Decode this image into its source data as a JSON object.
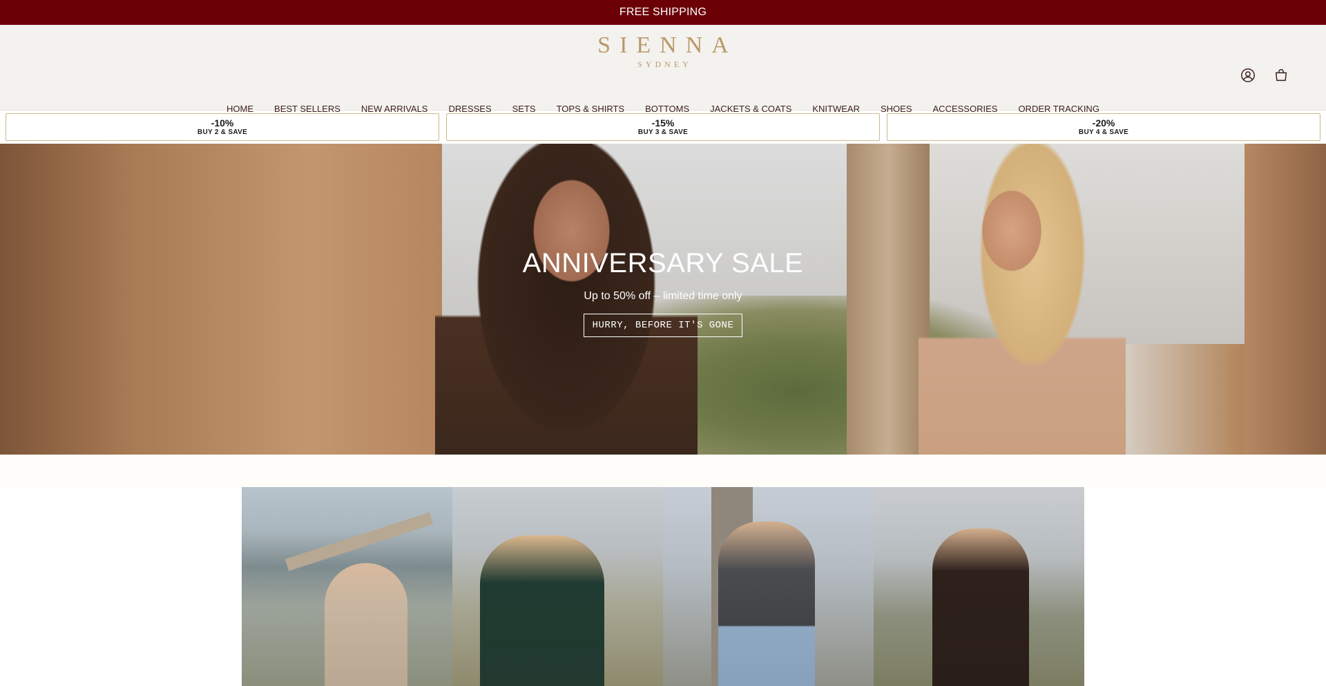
{
  "announcement": {
    "text": "FREE SHIPPING"
  },
  "brand": {
    "name": "SIENNA",
    "subtitle": "SYDNEY"
  },
  "header_icons": {
    "account": "account-icon",
    "cart": "cart-icon"
  },
  "nav": {
    "items": [
      "HOME",
      "BEST SELLERS",
      "NEW ARRIVALS",
      "DRESSES",
      "SETS",
      "TOPS & SHIRTS",
      "BOTTOMS",
      "JACKETS & COATS",
      "KNITWEAR",
      "SHOES",
      "ACCESSORIES",
      "ORDER TRACKING"
    ]
  },
  "discounts": [
    {
      "percent": "-10%",
      "label": "BUY 2 & SAVE"
    },
    {
      "percent": "-15%",
      "label": "BUY 3 & SAVE"
    },
    {
      "percent": "-20%",
      "label": "BUY 4 & SAVE"
    }
  ],
  "hero": {
    "title": "ANNIVERSARY SALE",
    "subtitle": "Up to 50% off – limited time only",
    "cta": "HURRY, BEFORE IT'S GONE"
  },
  "colors": {
    "announcement_bg": "#6b0007",
    "header_bg": "#f4f2ee",
    "brand_gold": "#b89a6c",
    "discount_border": "#c9b88b"
  }
}
